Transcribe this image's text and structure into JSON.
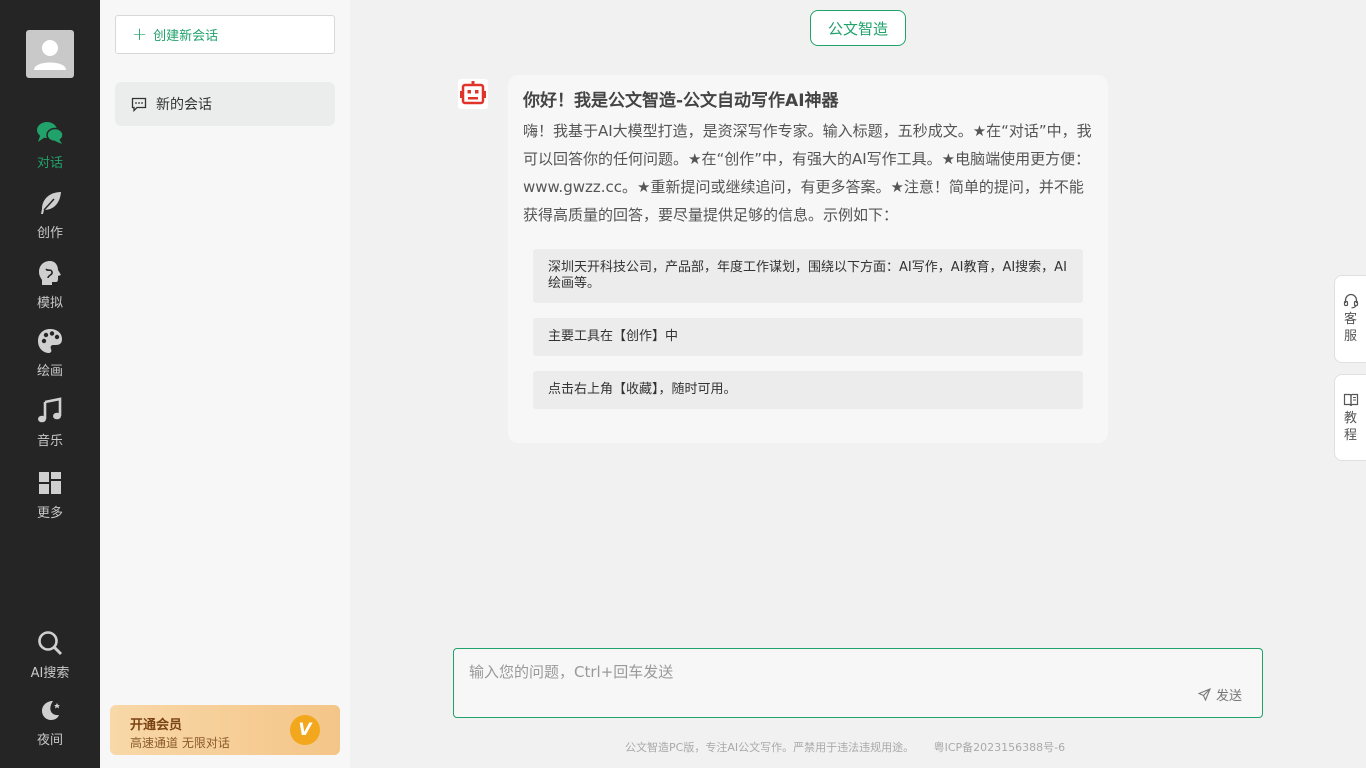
{
  "rail": {
    "items": [
      {
        "label": "对话",
        "icon": "chat-bubbles-icon",
        "active": true
      },
      {
        "label": "创作",
        "icon": "feather-icon",
        "active": false
      },
      {
        "label": "模拟",
        "icon": "head-profile-icon",
        "active": false
      },
      {
        "label": "绘画",
        "icon": "palette-icon",
        "active": false
      },
      {
        "label": "音乐",
        "icon": "music-note-icon",
        "active": false
      },
      {
        "label": "更多",
        "icon": "grid-icon",
        "active": false
      }
    ],
    "bottom": [
      {
        "label": "AI搜索",
        "icon": "search-icon"
      },
      {
        "label": "夜间",
        "icon": "moon-icon"
      }
    ]
  },
  "panel": {
    "new_chat_label": "创建新会话",
    "sessions": [
      {
        "title": "新的会话"
      }
    ],
    "vip": {
      "title": "开通会员",
      "subtitle": "高速通道 无限对话"
    }
  },
  "main": {
    "app_tag": "公文智造",
    "message": {
      "heading": "你好！我是公文智造-公文自动写作AI神器",
      "body": "嗨！我基于AI大模型打造，是资深写作专家。输入标题，五秒成文。★在“对话”中，我可以回答你的任何问题。★在“创作”中，有强大的AI写作工具。★电脑端使用更方便：www.gwzz.cc。★重新提问或继续追问，有更多答案。★注意！简单的提问，并不能获得高质量的回答，要尽量提供足够的信息。示例如下：",
      "suggestions": [
        "深圳天开科技公司，产品部，年度工作谋划，围绕以下方面：AI写作，AI教育，AI搜索，AI绘画等。",
        "主要工具在【创作】中",
        "点击右上角【收藏】，随时可用。"
      ]
    },
    "input": {
      "placeholder": "输入您的问题，Ctrl+回车发送",
      "value": "",
      "send_label": "发送"
    },
    "footer": {
      "text": "公文智造PC版，专注AI公文写作。严禁用于违法违规用途。",
      "icp": "粤ICP备2023156388号-6"
    }
  },
  "float_tabs": [
    {
      "label": "客服",
      "icon": "headset-icon"
    },
    {
      "label": "教程",
      "icon": "book-icon"
    }
  ],
  "colors": {
    "accent": "#21a26b",
    "rail_bg": "#252525",
    "vip_gold": "#f2a71c"
  }
}
